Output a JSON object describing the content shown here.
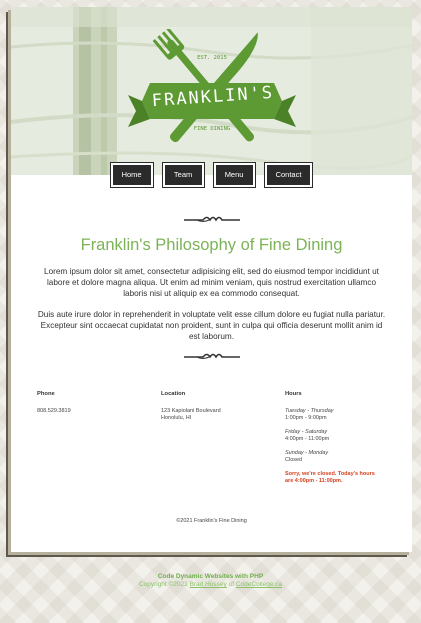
{
  "brand": {
    "name": "FRANKLIN'S",
    "established": "EST. 2015",
    "tagline": "FINE DINING",
    "accent_color": "#7cb356",
    "logo_icon": "fork-and-knife-icon"
  },
  "nav": {
    "items": [
      {
        "label": "Home"
      },
      {
        "label": "Team"
      },
      {
        "label": "Menu"
      },
      {
        "label": "Contact"
      }
    ]
  },
  "main": {
    "title": "Franklin's Philosophy of Fine Dining",
    "paragraphs": [
      "Lorem ipsum dolor sit amet, consectetur adipisicing elit, sed do eiusmod tempor incididunt ut labore et dolore magna aliqua. Ut enim ad minim veniam, quis nostrud exercitation ullamco laboris nisi ut aliquip ex ea commodo consequat.",
      "Duis aute irure dolor in reprehenderit in voluptate velit esse cillum dolore eu fugiat nulla pariatur. Excepteur sint occaecat cupidatat non proident, sunt in culpa qui officia deserunt mollit anim id est laborum."
    ]
  },
  "info": {
    "phone": {
      "label": "Phone",
      "value": "808.529.3819"
    },
    "location": {
      "label": "Location",
      "line1": "123 Kapiolani Boulevard",
      "line2": "Honolulu, HI"
    },
    "hours": {
      "label": "Hours",
      "entries": [
        {
          "days": "Tuesday - Thursday",
          "time": "1:00pm - 9:00pm"
        },
        {
          "days": "Friday - Saturday",
          "time": "4:00pm - 11:00pm"
        },
        {
          "days": "Sunday - Monday",
          "time": "Closed"
        }
      ],
      "alert_line1": "Sorry, we're closed. Today's hours",
      "alert_line2": "are 4:00pm - 11:00pm.",
      "alert_color": "#d6421e"
    }
  },
  "copyright": "©2021 Franklin's Fine Dining",
  "site_footer": {
    "line1": "Code Dynamic Websites with PHP",
    "copyright_prefix": "Copyright ©2021",
    "author": "Brad Hussey",
    "of": "of",
    "site": "CodeCollege.ca"
  }
}
